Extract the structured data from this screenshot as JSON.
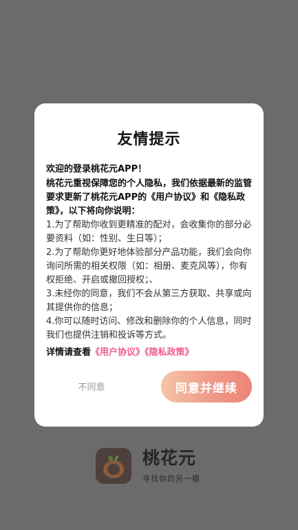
{
  "splash": {
    "app_name": "桃花元",
    "slogan": "寻找你的另一瓣"
  },
  "dialog": {
    "title": "友情提示",
    "greeting": "欢迎的登录桃花元APP！",
    "intro": "桃花元重视保障您的个人隐私，我们依据最新的监管要求更新了桃花元APP的《用户协议》和《隐私政策》，以下将向你说明：",
    "items": [
      "1.为了帮助你收到更精准的配对，会收集你的部分必要资料（如：性别、生日等）；",
      "2.为了帮助你更好地体验部分产品功能，我们会向你询问所需的相关权限（如：相册、麦克风等），你有权拒绝、开启或撤回授权；、",
      "3.未经你的同意，我们不会从第三方获取、共享或向其提供你的信息；",
      "4.你可以随时访问、修改和删除你的个人信息，同时我们也提供注销和投诉等方式。"
    ],
    "details_prefix": "详情请查看",
    "user_agreement_link": "《用户协议》",
    "privacy_policy_link": "《隐私政策》",
    "disagree_label": "不同意",
    "agree_label": "同意并继续"
  },
  "colors": {
    "overlay": "#6b6b6b",
    "link": "#ef5b8f",
    "agree_gradient_start": "#f4c6a6",
    "agree_gradient_end": "#ec8477",
    "disagree_text": "#9a9a9a"
  }
}
